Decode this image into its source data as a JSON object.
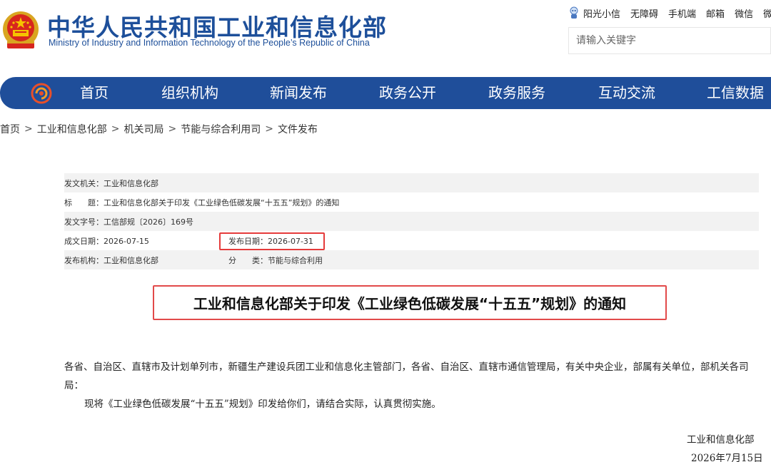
{
  "header": {
    "title": "中华人民共和国工业和信息化部",
    "subtitle": "Ministry of Industry and Information Technology of the People’s Republic of China",
    "top_links": [
      "阳光小信",
      "无障碍",
      "手机端",
      "邮箱",
      "微信",
      "微博"
    ],
    "search_placeholder": "请输入关键字"
  },
  "nav": {
    "items": [
      "首页",
      "组织机构",
      "新闻发布",
      "政务公开",
      "政务服务",
      "互动交流",
      "工信数据"
    ]
  },
  "breadcrumb": [
    "首页",
    "工业和信息化部",
    "机关司局",
    "节能与综合利用司",
    "文件发布"
  ],
  "meta": {
    "issuer_label": "发文机关：",
    "issuer": "工业和信息化部",
    "title_label": "标　　题：",
    "title": "工业和信息化部关于印发《工业绿色低碳发展“十五五”规划》的通知",
    "doc_number_label": "发文字号：",
    "doc_number": "工信部规〔2026〕169号",
    "written_date_label": "成文日期：",
    "written_date": "2026-07-15",
    "publish_date_label": "发布日期：",
    "publish_date": "2026-07-31",
    "publisher_label": "发布机构：",
    "publisher": "工业和信息化部",
    "category_label": "分　　类：",
    "category": "节能与综合利用"
  },
  "document": {
    "title": "工业和信息化部关于印发《工业绿色低碳发展“十五五”规划》的通知",
    "addressees": "各省、自治区、直辖市及计划单列市，新疆生产建设兵团工业和信息化主管部门，各省、自治区、直辖市通信管理局，有关中央企业，部属有关单位，部机关各司局：",
    "body": "现将《工业绿色低碳发展“十五五”规划》印发给你们，请结合实际，认真贯彻实施。",
    "signature_org": "工业和信息化部",
    "signature_date": "2026年7月15日"
  },
  "colors": {
    "brand_blue": "#1f4e9a",
    "highlight_red": "#e53b3b"
  }
}
